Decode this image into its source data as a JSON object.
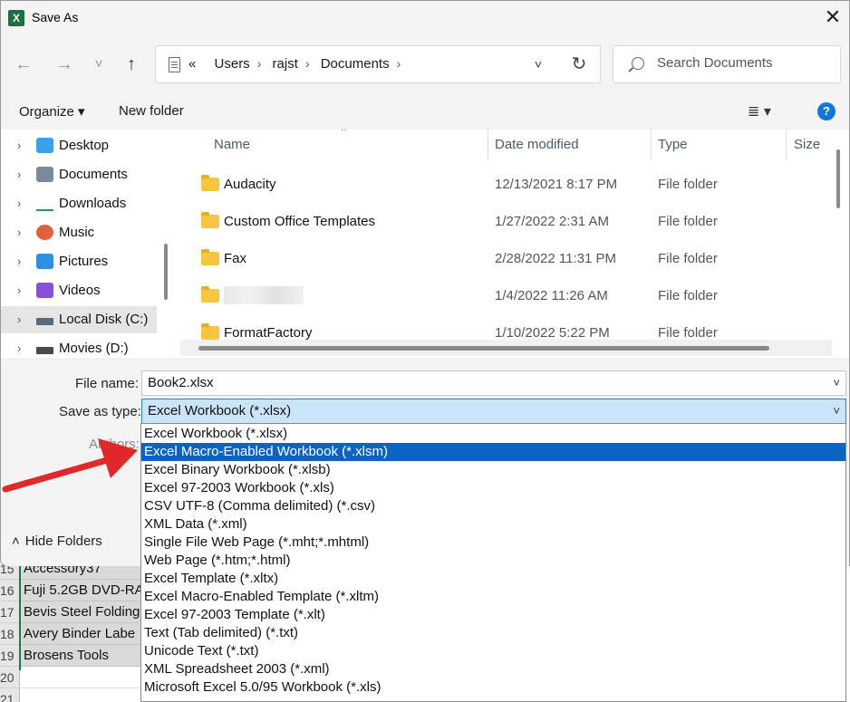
{
  "window": {
    "title": "Save As",
    "app_icon": "excel-icon",
    "close_glyph": "✕"
  },
  "nav": {
    "back_glyph": "←",
    "forward_glyph": "→",
    "recent_glyph": "˅",
    "up_glyph": "↑",
    "address": {
      "overflow": "«",
      "crumbs": [
        "Users",
        "rajst",
        "Documents"
      ],
      "dropdown_glyph": "˅",
      "refresh_glyph": "↻"
    },
    "search_placeholder": "Search Documents"
  },
  "commands": {
    "organize": "Organize ▾",
    "new_folder": "New folder",
    "view_glyph": "≣ ▾",
    "help_glyph": "?"
  },
  "tree": {
    "items": [
      {
        "label": "Desktop",
        "icon": "desktop-icon",
        "color": "#3aa0e8"
      },
      {
        "label": "Documents",
        "icon": "documents-icon",
        "color": "#7a8a9a"
      },
      {
        "label": "Downloads",
        "icon": "downloads-icon",
        "color": "#1f9d55"
      },
      {
        "label": "Music",
        "icon": "music-icon",
        "color": "#e06040"
      },
      {
        "label": "Pictures",
        "icon": "pictures-icon",
        "color": "#2f8ee0"
      },
      {
        "label": "Videos",
        "icon": "videos-icon",
        "color": "#8a4fd8"
      },
      {
        "label": "Local Disk (C:)",
        "icon": "local-disk-icon",
        "color": "#5a6a7a"
      },
      {
        "label": "Movies (D:)",
        "icon": "drive-icon",
        "color": "#4a4a4a"
      }
    ],
    "selected_index": 6,
    "chevron_glyph": "›"
  },
  "columns": {
    "name": "Name",
    "date_modified": "Date modified",
    "type": "Type",
    "size": "Size",
    "sort_glyph": "^"
  },
  "files": [
    {
      "name": "Audacity",
      "date": "12/13/2021 8:17 PM",
      "type": "File folder"
    },
    {
      "name": "Custom Office Templates",
      "date": "1/27/2022 2:31 AM",
      "type": "File folder"
    },
    {
      "name": "Fax",
      "date": "2/28/2022 11:31 PM",
      "type": "File folder"
    },
    {
      "name": "",
      "date": "1/4/2022 11:26 AM",
      "type": "File folder"
    },
    {
      "name": "FormatFactory",
      "date": "1/10/2022 5:22 PM",
      "type": "File folder"
    }
  ],
  "form": {
    "file_name_label": "File name:",
    "file_name_value": "Book2.xlsx",
    "save_type_label": "Save as type:",
    "save_type_value": "Excel Workbook (*.xlsx)",
    "authors_label": "Authors:",
    "dropdown_glyph": "˅"
  },
  "hide_folders": "Hide Folders",
  "hide_folders_glyph": "˄",
  "save_types": [
    "Excel Workbook (*.xlsx)",
    "Excel Macro-Enabled Workbook (*.xlsm)",
    "Excel Binary Workbook (*.xlsb)",
    "Excel 97-2003 Workbook (*.xls)",
    "CSV UTF-8 (Comma delimited) (*.csv)",
    "XML Data (*.xml)",
    "Single File Web Page (*.mht;*.mhtml)",
    "Web Page (*.htm;*.html)",
    "Excel Template (*.xltx)",
    "Excel Macro-Enabled Template (*.xltm)",
    "Excel 97-2003 Template (*.xlt)",
    "Text (Tab delimited) (*.txt)",
    "Unicode Text (*.txt)",
    "XML Spreadsheet 2003 (*.xml)",
    "Microsoft Excel 5.0/95 Workbook (*.xls)"
  ],
  "save_types_highlighted": 1,
  "sheet": {
    "rows": [
      {
        "num": "15",
        "value": "Accessory37"
      },
      {
        "num": "16",
        "value": "Fuji 5.2GB DVD-RA"
      },
      {
        "num": "17",
        "value": "Bevis Steel Folding"
      },
      {
        "num": "18",
        "value": "Avery Binder Labe"
      },
      {
        "num": "19",
        "value": "Brosens Tools"
      },
      {
        "num": "20",
        "value": ""
      },
      {
        "num": "21",
        "value": ""
      }
    ]
  },
  "colors": {
    "highlight": "#0a64c0",
    "arrow": "#e0282b",
    "excel_green": "#1d6f42"
  }
}
